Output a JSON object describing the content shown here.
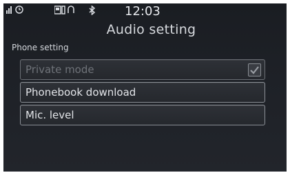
{
  "status_bar": {
    "signal_icon": "signal-strength-icon",
    "phone_icon": "phone-connection-icon",
    "bluetooth_icon": "bluetooth-icon",
    "time": "12:03"
  },
  "title": "Audio setting",
  "section_label": "Phone setting",
  "items": [
    {
      "label": "Private mode",
      "enabled": false,
      "checked": true
    },
    {
      "label": "Phonebook download",
      "enabled": true
    },
    {
      "label": "Mic. level",
      "enabled": true
    }
  ]
}
